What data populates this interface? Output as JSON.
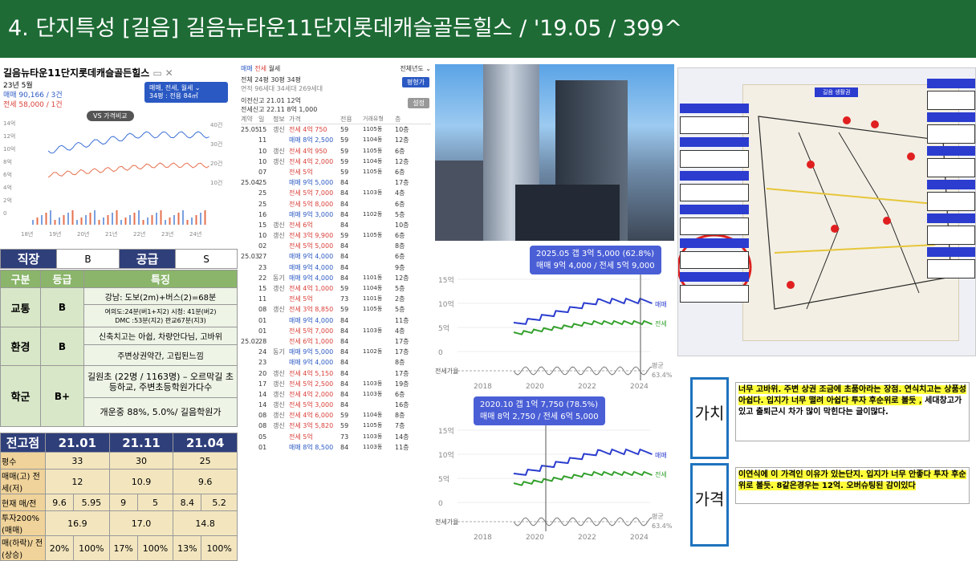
{
  "header": {
    "title": "4. 단지특성 [길음] 길음뉴타운11단지롯데캐슬골든힐스 / '19.05 / 399^"
  },
  "left": {
    "title": "길음뉴타운11단지롯데캐슬골든힐스",
    "title_icon": "map-icon",
    "date": "23년 5월",
    "sale": "매매 90,166 / 3건",
    "jeonse": "전세 58,000 / 1건",
    "chip_l1": "매매, 전세, 월세 ⌄",
    "chip_l2": "34평 : 전용 84㎡",
    "vs": "VS 가격비교",
    "y_left": [
      "14억",
      "12억",
      "10억",
      "8억",
      "6억",
      "4억",
      "2억",
      "0"
    ],
    "y_right": [
      "40건",
      "30건",
      "20건",
      "10건"
    ],
    "x": [
      "18년",
      "19년",
      "20년",
      "21년",
      "22년",
      "23년",
      "24년"
    ]
  },
  "grade": {
    "r1": [
      "직장",
      "B",
      "공급",
      "S"
    ],
    "hdr": [
      "구분",
      "등급",
      "특징"
    ],
    "traffic": [
      "교통",
      "B",
      "강남: 도보(2m)+버스(2)=68분",
      "여의도:24분(버1+지2) 시청: 41분(버2)",
      "DMC :53분(지2) 판교67분(지3)"
    ],
    "env": [
      "환경",
      "B",
      "신축치고는 아쉽, 차량안다님, 고바위",
      "주변상권약간, 고립된느낌"
    ],
    "school": [
      "학군",
      "B+",
      "길원초 (22명 / 1163명) – 오르막길 초등하교, 주변초등학원가다수",
      "개운중 88%, 5.0%/ 길음학원가"
    ]
  },
  "peak": {
    "hdr": [
      "전고점",
      "21.01",
      "21.11",
      "21.04"
    ],
    "rows": [
      [
        "평수",
        "33",
        "",
        "30",
        "",
        "25",
        ""
      ],
      [
        "매매(고) 전세(저)",
        "12",
        "",
        "10.9",
        "",
        "9.6",
        ""
      ],
      [
        "현재 매/전",
        "9.6",
        "5.95",
        "9",
        "5",
        "8.4",
        "5.2"
      ],
      [
        "투자200%(매매)",
        "16.9",
        "",
        "17.0",
        "",
        "14.8",
        ""
      ],
      [
        "매(하락)/ 전(상승)",
        "20%",
        "100%",
        "17%",
        "100%",
        "13%",
        "100%"
      ]
    ]
  },
  "tx": {
    "tabs": [
      "매매",
      "전세",
      "월세"
    ],
    "year": "전체년도 ⌄",
    "l1": "전체  24평  30평  34평",
    "l2": "면적  96세대  34세대  269세대",
    "rec1": "이전신고 21.01  12억",
    "rec2": "전세신고 22.11  8억 1,000",
    "btn1": "평형가",
    "btn2": "설정",
    "cols": [
      "계약",
      "일",
      "정보",
      "가격",
      "전용",
      "거래유형",
      "층"
    ],
    "rows": [
      [
        "25.05",
        "15",
        "갱신",
        "전세 4억 750",
        "59",
        "1105동",
        "10층"
      ],
      [
        "",
        "11",
        "",
        "매매 8억 2,500",
        "59",
        "1104동",
        "12층"
      ],
      [
        "",
        "10",
        "갱신",
        "전세 4억 950",
        "59",
        "1105동",
        "6층"
      ],
      [
        "",
        "10",
        "갱신",
        "전세 4억 2,000",
        "59",
        "1104동",
        "12층"
      ],
      [
        "",
        "07",
        "",
        "전세 5억",
        "59",
        "1105동",
        "6층"
      ],
      [
        "25.04",
        "25",
        "",
        "매매 9억 5,000",
        "84",
        "",
        "17층"
      ],
      [
        "",
        "25",
        "",
        "전세 5억 7,000",
        "84",
        "1103동",
        "4층"
      ],
      [
        "",
        "25",
        "",
        "전세 5억 8,000",
        "84",
        "",
        "6층"
      ],
      [
        "",
        "16",
        "",
        "매매 9억 3,000",
        "84",
        "1102동",
        "5층"
      ],
      [
        "",
        "15",
        "갱신",
        "전세 6억",
        "84",
        "",
        "10층"
      ],
      [
        "",
        "10",
        "갱신",
        "전세 3억 9,900",
        "59",
        "1105동",
        "6층"
      ],
      [
        "",
        "02",
        "",
        "전세 5억 5,000",
        "84",
        "",
        "8층"
      ],
      [
        "25.03",
        "27",
        "",
        "매매 9억 4,000",
        "84",
        "",
        "6층"
      ],
      [
        "",
        "23",
        "",
        "매매 9억 4,000",
        "84",
        "",
        "9층"
      ],
      [
        "",
        "22",
        "동기",
        "매매 9억 4,000",
        "84",
        "1101동",
        "12층"
      ],
      [
        "",
        "15",
        "갱신",
        "전세 4억 1,000",
        "59",
        "1104동",
        "5층"
      ],
      [
        "",
        "11",
        "",
        "전세 5억",
        "73",
        "1101동",
        "2층"
      ],
      [
        "",
        "08",
        "갱신",
        "전세 3억 8,850",
        "59",
        "1105동",
        "5층"
      ],
      [
        "",
        "01",
        "",
        "매매 9억 4,000",
        "84",
        "",
        "11층"
      ],
      [
        "",
        "01",
        "",
        "전세 5억 7,000",
        "84",
        "1103동",
        "4층"
      ],
      [
        "25.02",
        "28",
        "",
        "전세 6억 1,000",
        "84",
        "",
        "17층"
      ],
      [
        "",
        "24",
        "동기",
        "매매 9억 5,000",
        "84",
        "1102동",
        "17층"
      ],
      [
        "",
        "23",
        "",
        "매매 9억 4,000",
        "84",
        "",
        "8층"
      ],
      [
        "",
        "20",
        "갱신",
        "전세 4억 5,150",
        "84",
        "",
        "17층"
      ],
      [
        "",
        "17",
        "갱신",
        "전세 5억 2,500",
        "84",
        "1103동",
        "19층"
      ],
      [
        "",
        "14",
        "갱신",
        "전세 4억 2,000",
        "84",
        "1103동",
        "6층"
      ],
      [
        "",
        "14",
        "갱신",
        "전세 5억 3,000",
        "84",
        "",
        "16층"
      ],
      [
        "",
        "08",
        "갱신",
        "전세 4억 6,000",
        "59",
        "1104동",
        "8층"
      ],
      [
        "",
        "08",
        "갱신",
        "전세 3억 5,820",
        "59",
        "1105동",
        "7층"
      ],
      [
        "",
        "05",
        "",
        "전세 5억",
        "73",
        "1103동",
        "14층"
      ],
      [
        "",
        "01",
        "",
        "매매 8억 8,500",
        "84",
        "1103동",
        "11층"
      ]
    ]
  },
  "c1": {
    "tip1": "2025.05  갭 3억 5,000 (62.8%)",
    "tip2": "매매 9억 4,000 / 전세 5억 9,000",
    "y": [
      "15억",
      "10억",
      "5억",
      "0"
    ],
    "x": [
      "2018",
      "2020",
      "2022",
      "2024"
    ],
    "s1": "매매",
    "s2": "전세",
    "rate": "전세가율",
    "avg": "평균",
    "avgv": "63.4%"
  },
  "c2": {
    "tip1": "2020.10  갭 1억 7,750 (78.5%)",
    "tip2": "매매 8억 2,750 / 전세 6억 5,000",
    "y": [
      "15억",
      "10억",
      "5억",
      "0"
    ],
    "x": [
      "2018",
      "2020",
      "2022",
      "2024"
    ],
    "s1": "매매",
    "s2": "전세",
    "rate": "전세가율",
    "avg": "평균",
    "avgv": "63.4%"
  },
  "map": {
    "label": "길음 생활권"
  },
  "notes": {
    "ga1": "가치",
    "txt1a": "너무 고바위. 주변 상권 조금에 초품아라는 장점. 연식치고는 상품성 아쉽다. 입지가 너무 떨려 아쉽다 투자 후순위로 볼듯 ,",
    "txt1b": " 세대창고가 있고 출퇴근시 차가 많이 막힌다는 글이많다.",
    "ga2": "가격",
    "txt2": "이연식에 이 가격인 이유가 있는단지. 입지가 너무 안좋다 투자 후순위로 볼듯. 8같은경우는 12억. 오버슈팅된 감이있다"
  },
  "colors": {
    "header": "#1e6b35",
    "sale": "#2b59c3",
    "jeonse": "#e6704e",
    "green": "#33a02c",
    "blue": "#2b3ccf"
  }
}
